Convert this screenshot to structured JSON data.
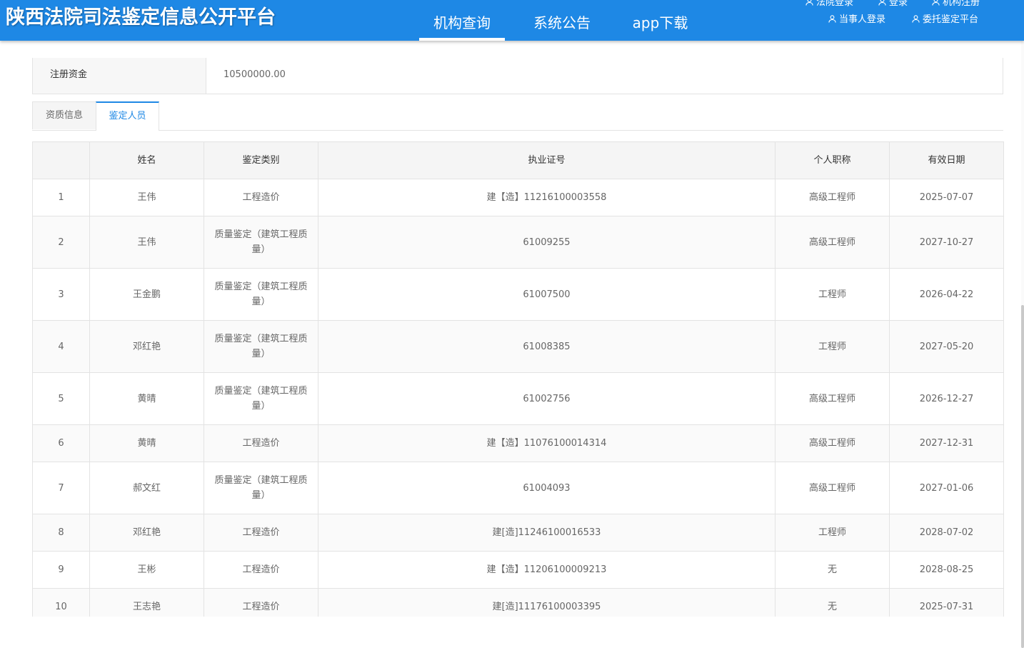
{
  "header": {
    "site_title": "陕西法院司法鉴定信息公开平台",
    "nav": [
      {
        "label": "机构查询",
        "active": true
      },
      {
        "label": "系统公告",
        "active": false
      },
      {
        "label": "app下载",
        "active": false
      }
    ],
    "user_links": {
      "court_login": "法院登录",
      "login": "登录",
      "org_register": "机构注册",
      "party_login": "当事人登录",
      "entrust_platform": "委托鉴定平台"
    },
    "accent_color": "#1e88e5"
  },
  "info": {
    "label": "注册资金",
    "value": "10500000.00"
  },
  "tabs": [
    {
      "label": "资质信息",
      "active": false
    },
    {
      "label": "鉴定人员",
      "active": true
    }
  ],
  "table": {
    "columns": [
      "",
      "姓名",
      "鉴定类别",
      "执业证号",
      "个人职称",
      "有效日期"
    ],
    "rows": [
      {
        "no": "1",
        "name": "王伟",
        "category": "工程造价",
        "cert": "建【造】11216100003558",
        "title": "高级工程师",
        "date": "2025-07-07"
      },
      {
        "no": "2",
        "name": "王伟",
        "category": "质量鉴定（建筑工程质量）",
        "cert": "61009255",
        "title": "高级工程师",
        "date": "2027-10-27"
      },
      {
        "no": "3",
        "name": "王金鹏",
        "category": "质量鉴定（建筑工程质量）",
        "cert": "61007500",
        "title": "工程师",
        "date": "2026-04-22"
      },
      {
        "no": "4",
        "name": "邓红艳",
        "category": "质量鉴定（建筑工程质量）",
        "cert": "61008385",
        "title": "工程师",
        "date": "2027-05-20"
      },
      {
        "no": "5",
        "name": "黄晴",
        "category": "质量鉴定（建筑工程质量）",
        "cert": "61002756",
        "title": "高级工程师",
        "date": "2026-12-27"
      },
      {
        "no": "6",
        "name": "黄晴",
        "category": "工程造价",
        "cert": "建【造】11076100014314",
        "title": "高级工程师",
        "date": "2027-12-31"
      },
      {
        "no": "7",
        "name": "郝文红",
        "category": "质量鉴定（建筑工程质量）",
        "cert": "61004093",
        "title": "高级工程师",
        "date": "2027-01-06"
      },
      {
        "no": "8",
        "name": "邓红艳",
        "category": "工程造价",
        "cert": "建[造]11246100016533",
        "title": "工程师",
        "date": "2028-07-02"
      },
      {
        "no": "9",
        "name": "王彬",
        "category": "工程造价",
        "cert": "建【造】11206100009213",
        "title": "无",
        "date": "2028-08-25"
      },
      {
        "no": "10",
        "name": "王志艳",
        "category": "工程造价",
        "cert": "建[造]11176100003395",
        "title": "无",
        "date": "2025-07-31"
      }
    ]
  }
}
